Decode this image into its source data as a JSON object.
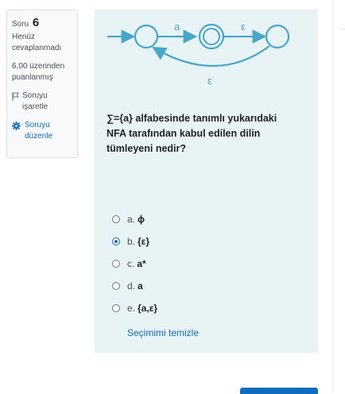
{
  "info": {
    "question_label": "Soru",
    "question_number": "6",
    "status_line1": "Henüz",
    "status_line2": "cevaplanmadı",
    "mark_line1": "6,00 üzerinden",
    "mark_line2": "puanlanmış",
    "flag_line1": "Soruyu",
    "flag_line2": "işaretle",
    "edit_line1": "Soruyu",
    "edit_line2": "düzenle"
  },
  "diagram": {
    "top_label_1": "a",
    "top_label_2": "ε",
    "bottom_label": "ε",
    "color": "#4aa6c9"
  },
  "question": {
    "line1": "∑={a} alfabesinde tanımlı yukarıdaki",
    "line2": "NFA tarafından kabul edilen dilin",
    "line3": "tümleyeni nedir?"
  },
  "answers": [
    {
      "letter": "a.",
      "value": "ɸ",
      "selected": false
    },
    {
      "letter": "b.",
      "value": "{ε}",
      "selected": true
    },
    {
      "letter": "c.",
      "value": "a*",
      "selected": false
    },
    {
      "letter": "d.",
      "value": "a",
      "selected": false
    },
    {
      "letter": "e.",
      "value": "{a,ε}",
      "selected": false
    }
  ],
  "clear_choice": "Seçimimi temizle",
  "colors": {
    "accent": "#0f6cbf",
    "panel_bg": "#e7f3f5",
    "info_bg": "#f8f9fa"
  }
}
